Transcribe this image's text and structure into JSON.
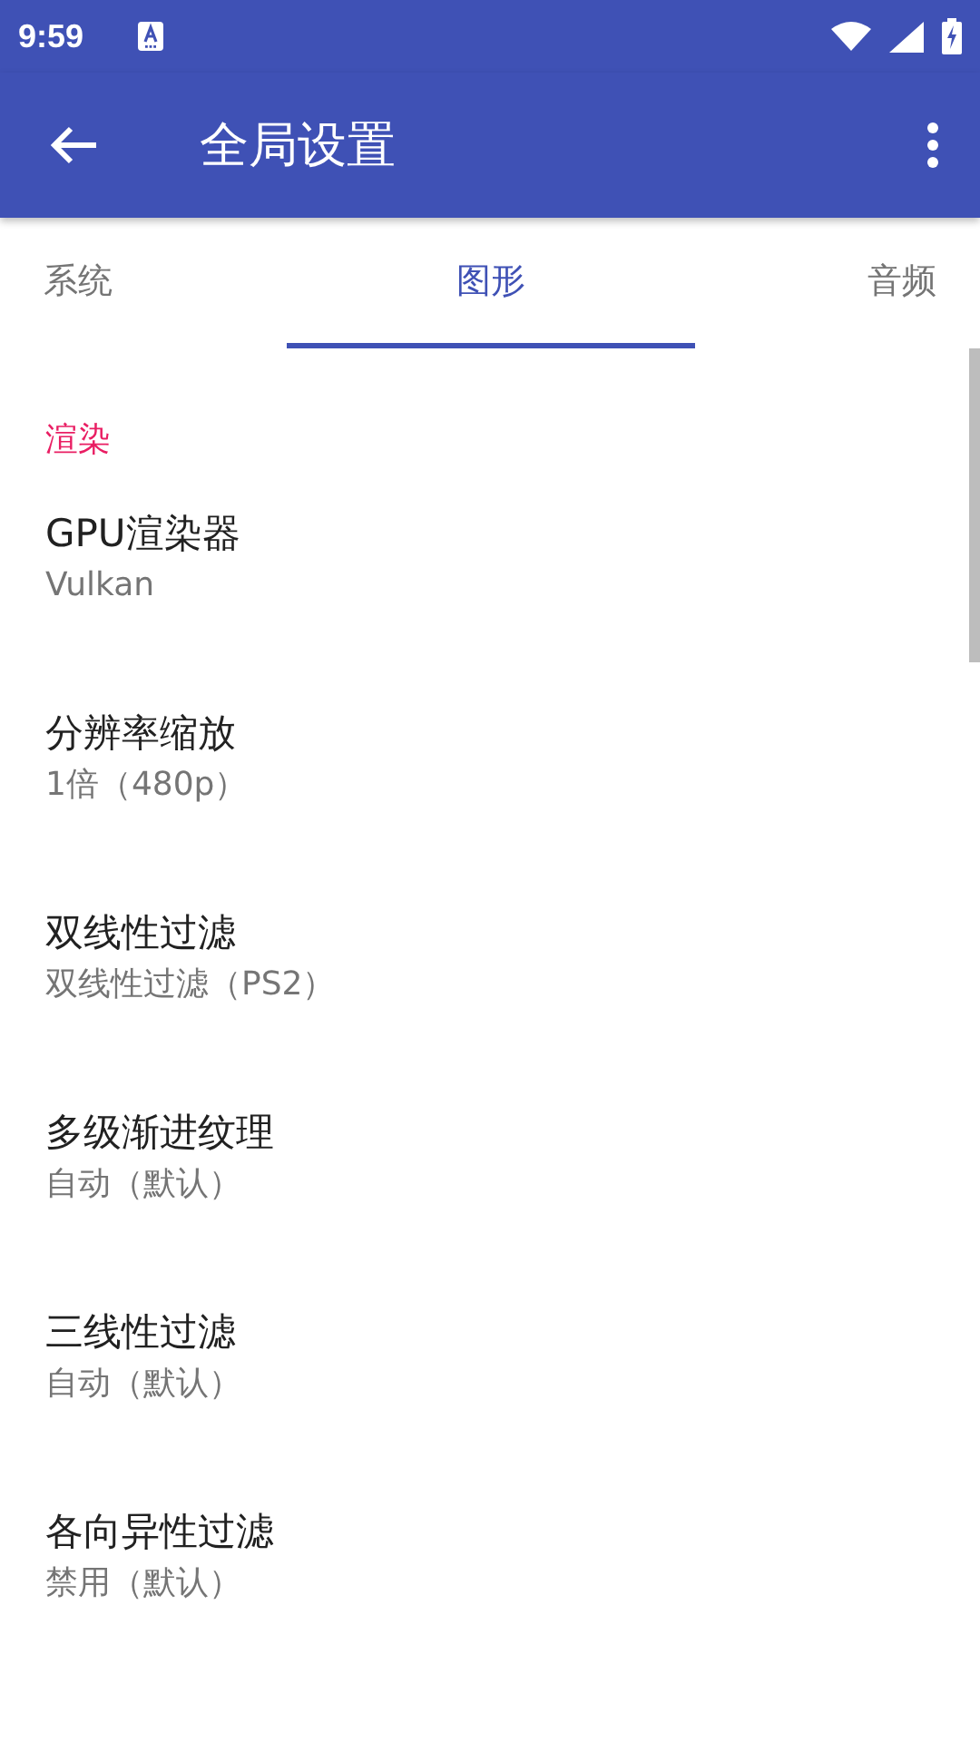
{
  "status_bar": {
    "time": "9:59"
  },
  "app_bar": {
    "title": "全局设置"
  },
  "tabs": [
    {
      "label": "系统",
      "selected": false
    },
    {
      "label": "图形",
      "selected": true
    },
    {
      "label": "音频",
      "selected": false
    }
  ],
  "section": {
    "title": "渲染"
  },
  "settings": [
    {
      "title": "GPU渲染器",
      "value": "Vulkan"
    },
    {
      "title": "分辨率缩放",
      "value": "1倍（480p）"
    },
    {
      "title": "双线性过滤",
      "value": "双线性过滤（PS2）"
    },
    {
      "title": "多级渐进纹理",
      "value": "自动（默认）"
    },
    {
      "title": "三线性过滤",
      "value": "自动（默认）"
    },
    {
      "title": "各向异性过滤",
      "value": "禁用（默认）"
    }
  ]
}
